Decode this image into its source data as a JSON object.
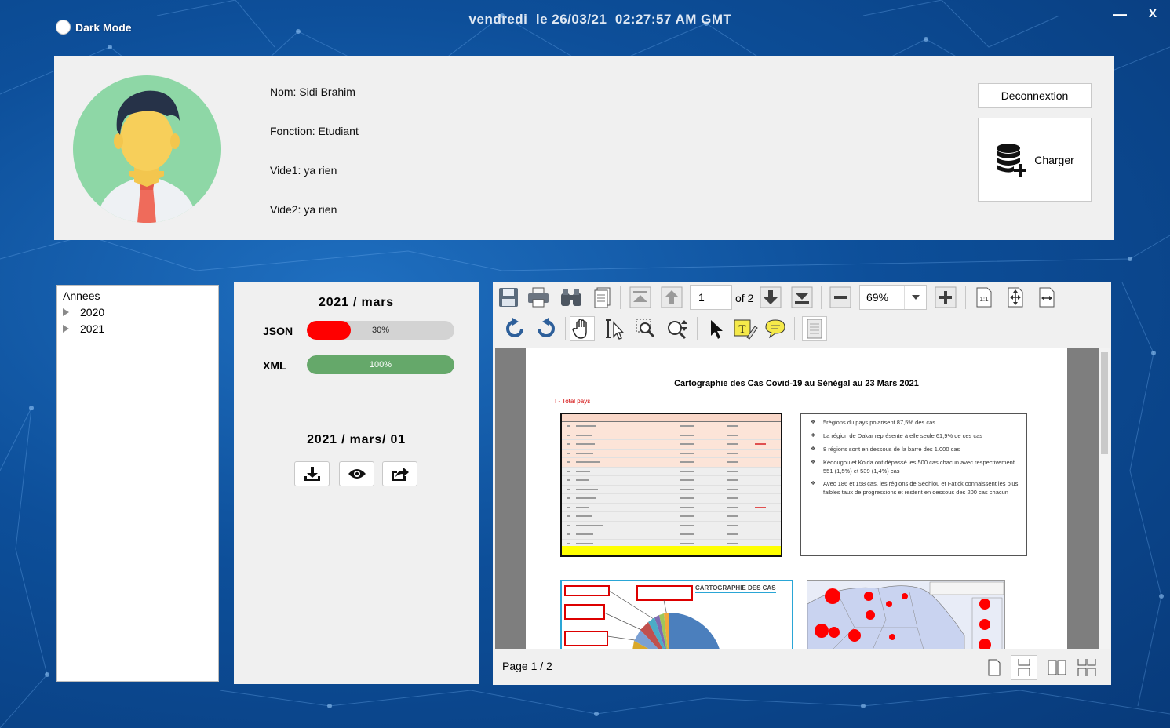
{
  "window": {
    "dark_mode_label": "Dark Mode",
    "datetime": "vendredi  le 26/03/21  02:27:57 AM GMT",
    "minimize_symbol": "—",
    "close_symbol": "X"
  },
  "profile": {
    "nom": "Nom: Sidi Brahim",
    "fonction": "Fonction: Etudiant",
    "vide1": "Vide1: ya rien",
    "vide2": "Vide2: ya rien",
    "logout_label": "Deconnextion",
    "load_label": "Charger"
  },
  "tree": {
    "root": "Annees",
    "items": [
      "2020",
      "2021"
    ]
  },
  "progress": {
    "period_title": "2021 / mars",
    "json_label": "JSON",
    "json_percent": 30,
    "json_text": "30%",
    "xml_label": "XML",
    "xml_percent": 100,
    "xml_text": "100%",
    "day_title": "2021 / mars/ 01",
    "json_color": "#ff0000",
    "xml_color": "#65a86a"
  },
  "viewer": {
    "page_input": "1",
    "of_label": "of 2",
    "zoom": "69%",
    "page_status": "Page 1 / 2",
    "doc": {
      "title": "Cartographie des Cas Covid-19 au Sénégal au 23 Mars 2021",
      "section": "I - Total pays",
      "bullets": [
        "5régions du pays polarisent 87,5% des cas",
        "La région de Dakar représente à elle seule 61,9% de ces cas",
        "8 régions sont en dessous de la barre des 1.000 cas",
        "Kédougou et Kolda ont dépassé les 500 cas chacun avec respectivement 551 (1,5%) et 539 (1,4%) cas",
        "Avec 186 et 158 cas, les régions de Sédhiou et Fatick connaissent les plus faibles taux de progressions et restent en dessous des 200 cas chacun"
      ],
      "chart_title": "CARTOGRAPHIE DES CAS"
    }
  }
}
